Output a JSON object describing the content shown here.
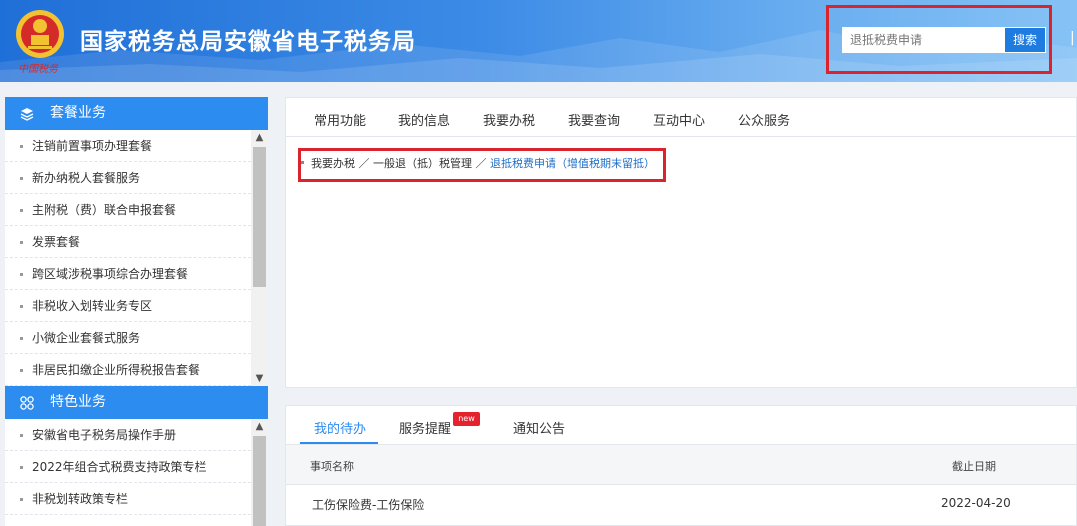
{
  "header": {
    "title": "国家税务总局安徽省电子税务局",
    "emblem_text": "中国税务",
    "search": {
      "placeholder": "退抵税费申请",
      "button_label": "搜索"
    },
    "edge_glyph": "|"
  },
  "sidebar": {
    "sections": [
      {
        "title": "套餐业务",
        "icon": "layers-icon",
        "items": [
          "注销前置事项办理套餐",
          "新办纳税人套餐服务",
          "主附税（费）联合申报套餐",
          "发票套餐",
          "跨区域涉税事项综合办理套餐",
          "非税收入划转业务专区",
          "小微企业套餐式服务",
          "非居民扣缴企业所得税报告套餐"
        ]
      },
      {
        "title": "特色业务",
        "icon": "grid-icon",
        "items": [
          "安徽省电子税务局操作手册",
          "2022年组合式税费支持政策专栏",
          "非税划转政策专栏"
        ]
      }
    ]
  },
  "main": {
    "tabs": [
      "常用功能",
      "我的信息",
      "我要办税",
      "我要查询",
      "互动中心",
      "公众服务"
    ],
    "breadcrumb": {
      "part1": "我要办税",
      "sep": "／",
      "part2": "一般退（抵）税管理",
      "part3": "退抵税费申请（增值税期末留抵）"
    }
  },
  "bottom": {
    "tabs": [
      "我的待办",
      "服务提醒",
      "通知公告"
    ],
    "badge": "new",
    "columns": [
      "事项名称",
      "截止日期"
    ],
    "rows": [
      {
        "name": "工伤保险费-工伤保险",
        "date": "2022-04-20"
      }
    ]
  },
  "colors": {
    "accent": "#2d8cf0",
    "highlight": "#d9232d",
    "link": "#1e6fc8"
  }
}
